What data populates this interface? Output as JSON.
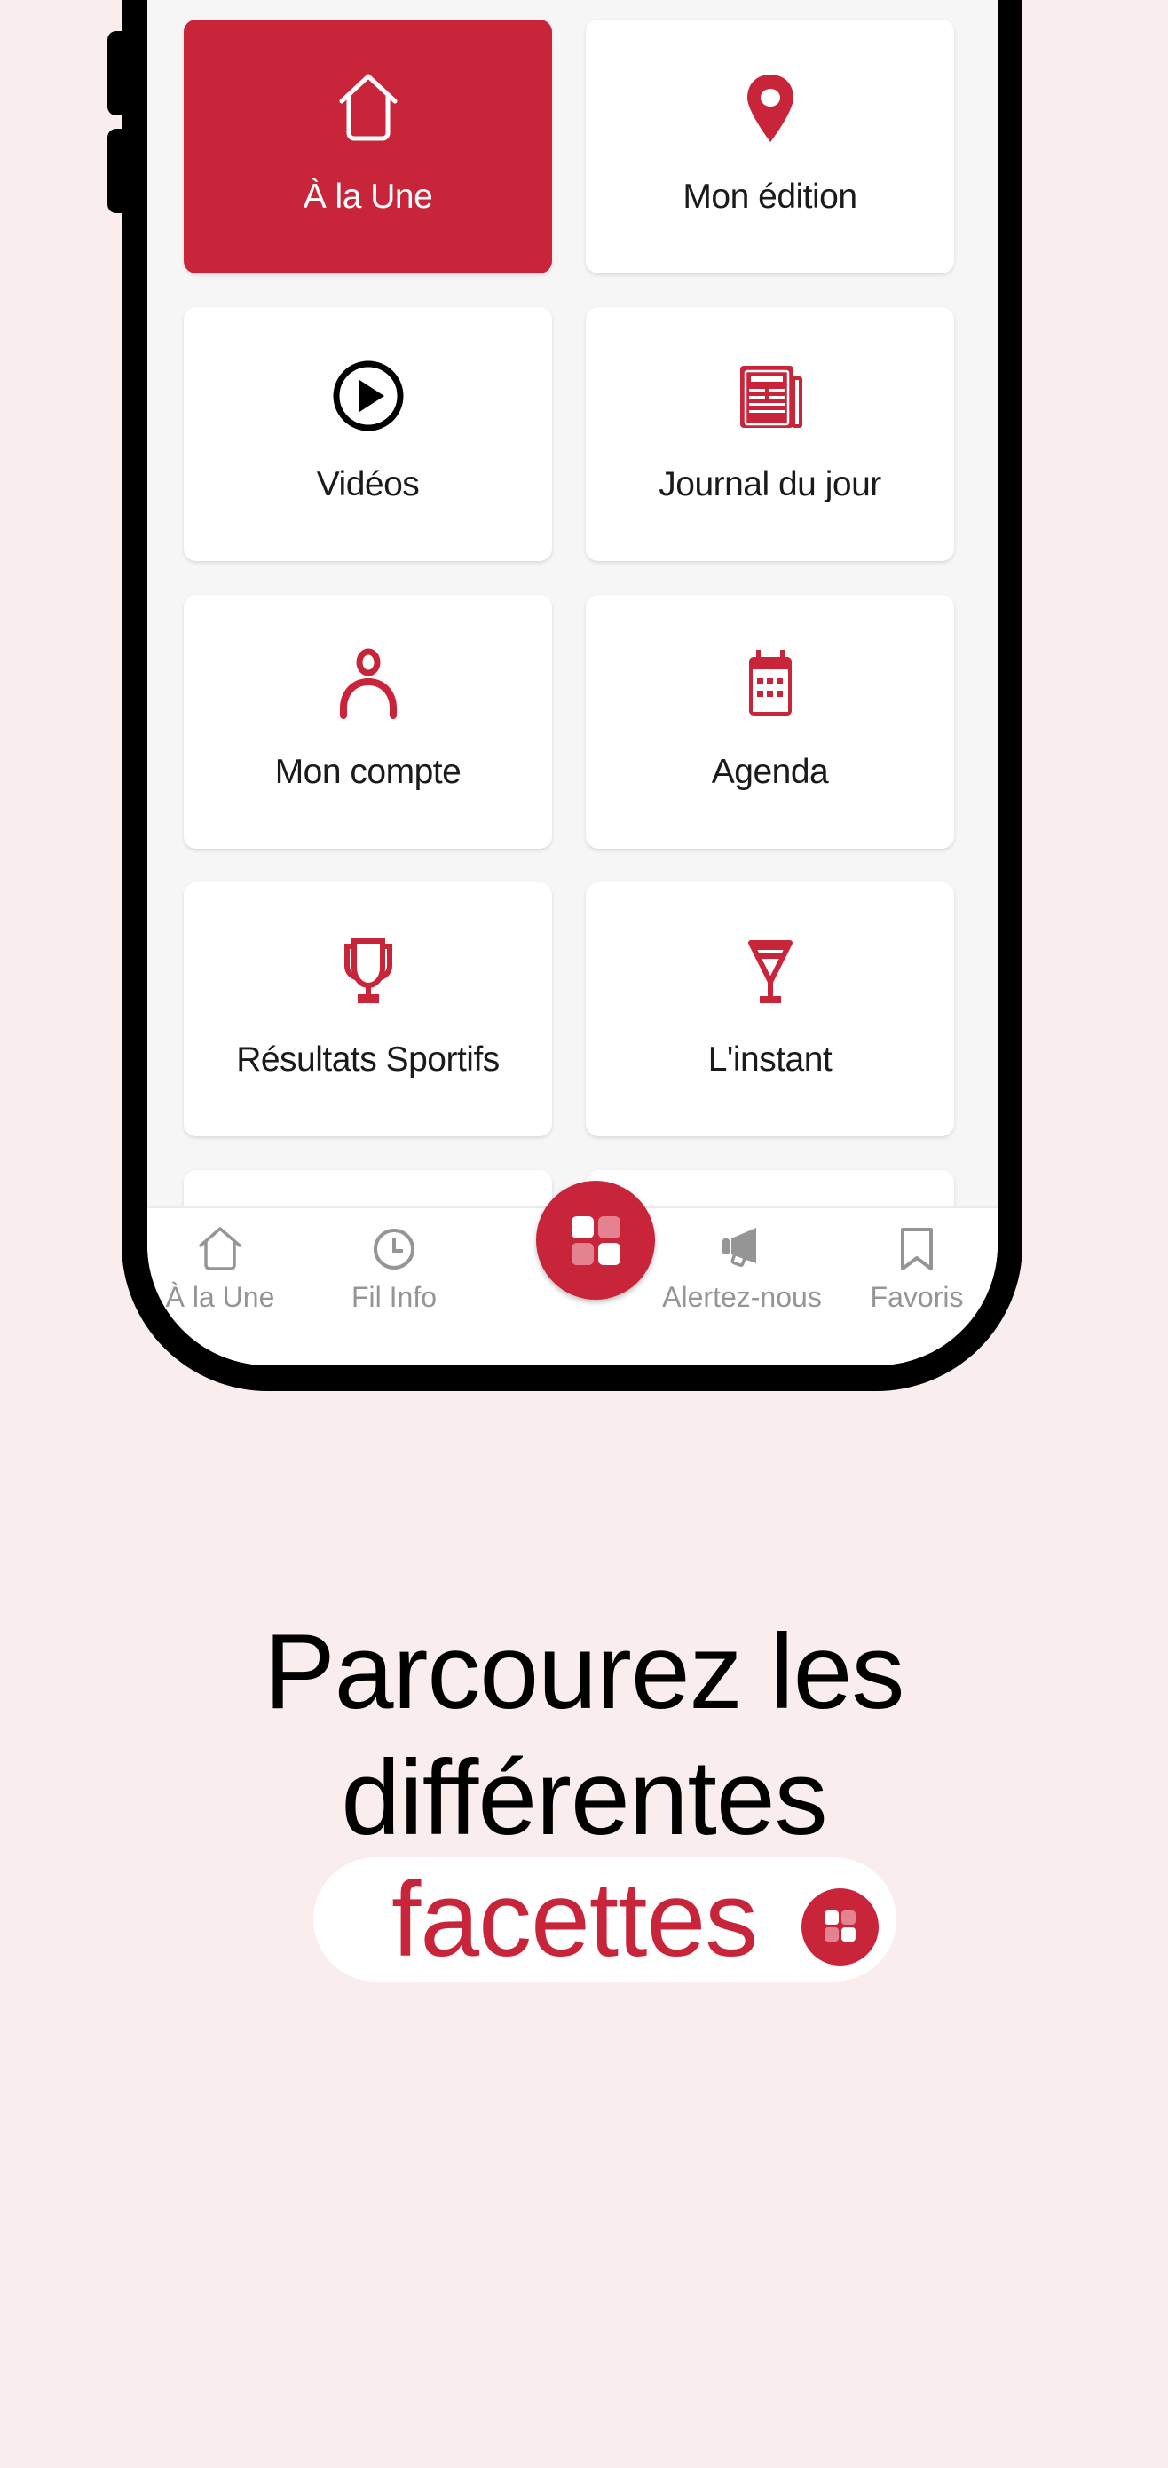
{
  "colors": {
    "brand_red": "#C8243A",
    "page_background": "#F9EDED",
    "screen_background": "#F6F6F6",
    "nav_inactive": "#959595"
  },
  "menu": {
    "tiles": [
      {
        "label": "À la Une",
        "icon": "home-icon",
        "active": true
      },
      {
        "label": "Mon édition",
        "icon": "location-pin-icon",
        "active": false
      },
      {
        "label": "Vidéos",
        "icon": "play-circle-icon",
        "active": false
      },
      {
        "label": "Journal du jour",
        "icon": "newspaper-icon",
        "active": false
      },
      {
        "label": "Mon compte",
        "icon": "user-icon",
        "active": false
      },
      {
        "label": "Agenda",
        "icon": "calendar-icon",
        "active": false
      },
      {
        "label": "Résultats Sportifs",
        "icon": "trophy-icon",
        "active": false
      },
      {
        "label": "L'instant",
        "icon": "cocktail-glass-icon",
        "active": false
      }
    ]
  },
  "bottom_nav": {
    "items": [
      {
        "label": "À la Une",
        "icon": "home-icon"
      },
      {
        "label": "Fil Info",
        "icon": "clock-icon"
      },
      {
        "label": "",
        "icon": "apps-grid-icon"
      },
      {
        "label": "Alertez-nous",
        "icon": "megaphone-icon"
      },
      {
        "label": "Favoris",
        "icon": "bookmark-icon"
      }
    ]
  },
  "caption": {
    "line1": "Parcourez les",
    "line2": "différentes",
    "highlight": "facettes"
  }
}
